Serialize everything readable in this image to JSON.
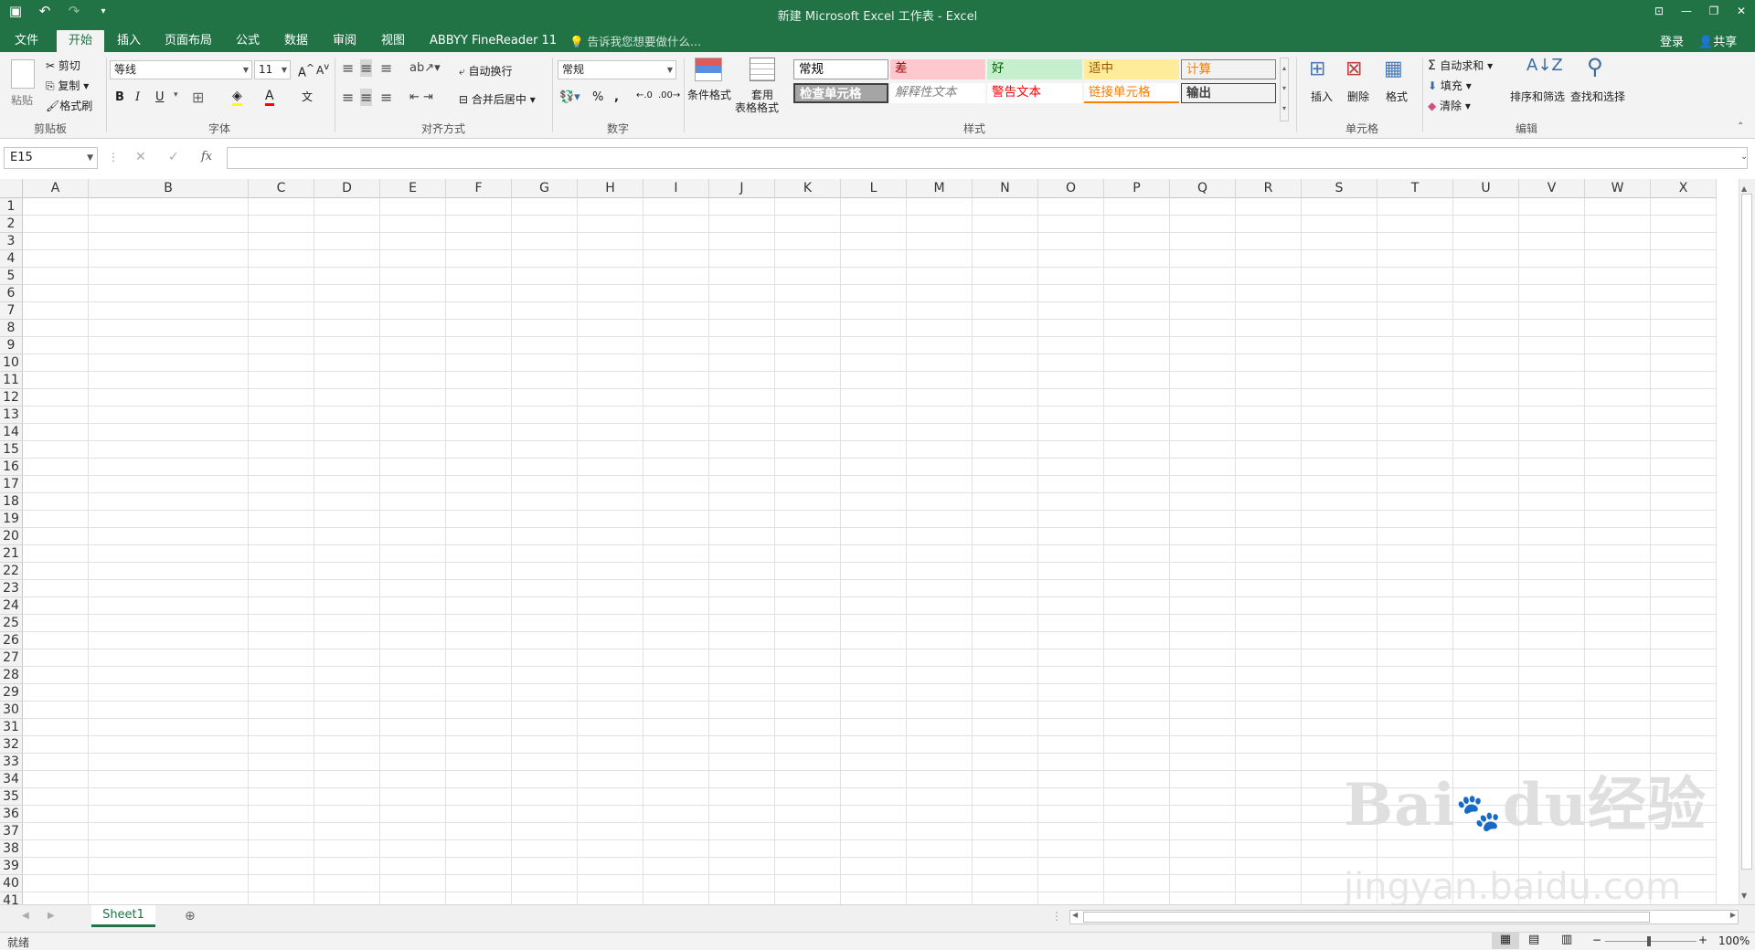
{
  "titlebar": {
    "title": "新建 Microsoft Excel 工作表 - Excel",
    "qat": [
      "save-icon",
      "undo-icon",
      "redo-icon",
      "customize-icon"
    ],
    "win_buttons": [
      "ribbon-options-icon",
      "minimize-icon",
      "restore-icon",
      "close-icon"
    ]
  },
  "tabs": [
    "文件",
    "开始",
    "插入",
    "页面布局",
    "公式",
    "数据",
    "审阅",
    "视图",
    "ABBYY FineReader 11"
  ],
  "active_tab": "开始",
  "tell_me": "告诉我您想要做什么...",
  "login": "登录",
  "share": "共享",
  "ribbon": {
    "clipboard": {
      "paste": "粘贴",
      "cut": "剪切",
      "copy": "复制",
      "format_painter": "格式刷",
      "label": "剪贴板"
    },
    "font": {
      "name": "等线",
      "size": "11",
      "bold": "B",
      "italic": "I",
      "underline": "U",
      "label": "字体"
    },
    "alignment": {
      "wrap": "自动换行",
      "merge": "合并后居中",
      "label": "对齐方式"
    },
    "number": {
      "format": "常规",
      "label": "数字"
    },
    "styles": {
      "cond_format": "条件格式",
      "table_format_1": "套用",
      "table_format_2": "表格格式",
      "cells_row1": [
        {
          "text": "常规",
          "bg": "#ffffff",
          "fg": "#000000"
        },
        {
          "text": "差",
          "bg": "#ffc7ce",
          "fg": "#9c0006"
        },
        {
          "text": "好",
          "bg": "#c6efce",
          "fg": "#006100"
        },
        {
          "text": "适中",
          "bg": "#ffeb9c",
          "fg": "#9c5700"
        },
        {
          "text": "计算",
          "bg": "#f2f2f2",
          "fg": "#fa7d00"
        }
      ],
      "cells_row2": [
        {
          "text": "检查单元格",
          "bg": "#a5a5a5",
          "fg": "#ffffff"
        },
        {
          "text": "解释性文本",
          "bg": "#ffffff",
          "fg": "#7f7f7f"
        },
        {
          "text": "警告文本",
          "bg": "#ffffff",
          "fg": "#ff0000"
        },
        {
          "text": "链接单元格",
          "bg": "#ffffff",
          "fg": "#fa7d00"
        },
        {
          "text": "输出",
          "bg": "#f2f2f2",
          "fg": "#3f3f3f"
        }
      ],
      "label": "样式"
    },
    "cells": {
      "insert": "插入",
      "delete": "删除",
      "format": "格式",
      "label": "单元格"
    },
    "editing": {
      "autosum": "自动求和",
      "fill": "填充",
      "clear": "清除",
      "sort": "排序和筛选",
      "find": "查找和选择",
      "label": "编辑"
    }
  },
  "formula_bar": {
    "name_box": "E15",
    "fx": "fx",
    "value": ""
  },
  "columns": [
    "A",
    "B",
    "C",
    "D",
    "E",
    "F",
    "G",
    "H",
    "I",
    "J",
    "K",
    "L",
    "M",
    "N",
    "O",
    "P",
    "Q",
    "R",
    "S",
    "T",
    "U",
    "V",
    "W",
    "X"
  ],
  "rows": [
    "1",
    "2",
    "3",
    "4",
    "5",
    "6",
    "7",
    "8",
    "9",
    "10",
    "11",
    "12",
    "13",
    "14",
    "15",
    "16",
    "17",
    "18",
    "19",
    "20",
    "21",
    "22",
    "23",
    "24",
    "25",
    "26",
    "27",
    "28",
    "29",
    "30",
    "31",
    "32",
    "33",
    "34",
    "35",
    "36",
    "37",
    "38",
    "39",
    "40",
    "41"
  ],
  "sheet_tab": "Sheet1",
  "status": {
    "ready": "就绪",
    "zoom": "100%"
  },
  "watermark": {
    "brand": "Bai",
    "brand2": "du",
    "cn": "经验",
    "url": "jingyan.baidu.com"
  }
}
